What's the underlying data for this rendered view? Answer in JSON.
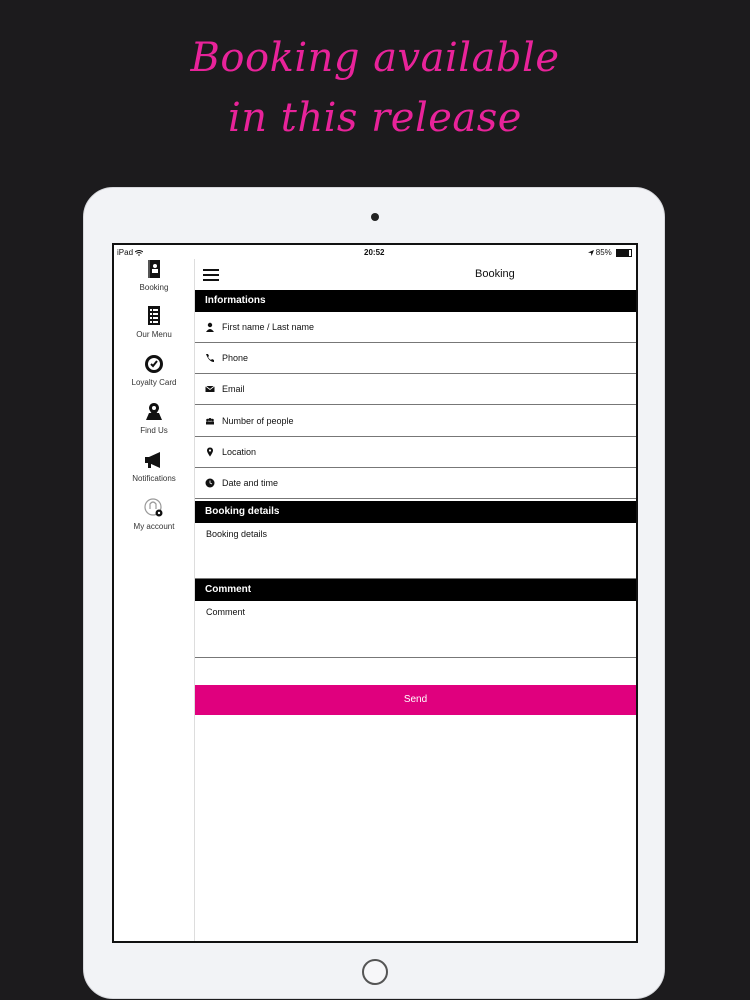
{
  "promo": {
    "line1": "Booking available",
    "line2": "in this release",
    "color": "#e8239a"
  },
  "status_bar": {
    "carrier": "iPad",
    "time": "20:52",
    "battery": "85%",
    "battery_level": 0.85
  },
  "sidebar": {
    "items": [
      {
        "label": "Booking",
        "icon": "booking-icon"
      },
      {
        "label": "Our Menu",
        "icon": "menu-icon"
      },
      {
        "label": "Loyalty Card",
        "icon": "loyalty-icon"
      },
      {
        "label": "Find Us",
        "icon": "map-icon"
      },
      {
        "label": "Notifications",
        "icon": "megaphone-icon"
      },
      {
        "label": "My account",
        "icon": "account-icon"
      }
    ]
  },
  "header": {
    "title": "Booking"
  },
  "informations": {
    "title": "Informations",
    "fields": [
      {
        "placeholder": "First name / Last name",
        "icon": "person-icon"
      },
      {
        "placeholder": "Phone",
        "icon": "phone-icon"
      },
      {
        "placeholder": "Email",
        "icon": "email-icon"
      },
      {
        "placeholder": "Number of people",
        "icon": "people-icon"
      },
      {
        "placeholder": "Location",
        "icon": "location-icon"
      },
      {
        "placeholder": "Date and time",
        "icon": "clock-icon"
      }
    ]
  },
  "booking_details": {
    "title": "Booking details",
    "placeholder": "Booking details"
  },
  "comment": {
    "title": "Comment",
    "placeholder": "Comment"
  },
  "send": {
    "label": "Send",
    "color": "#e0007e"
  }
}
